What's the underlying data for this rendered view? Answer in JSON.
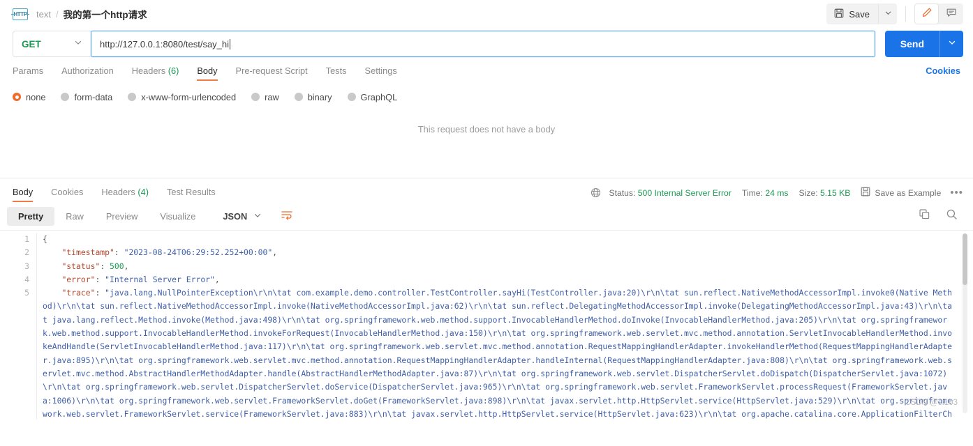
{
  "breadcrumb": {
    "icon": "http-protocol-icon",
    "collection": "text",
    "separator": "/",
    "request_name": "我的第一个http请求"
  },
  "topbar": {
    "save_label": "Save",
    "save_icon": "floppy-disk-icon",
    "save_caret_icon": "chevron-down-icon",
    "edit_icon": "pencil-icon",
    "comment_icon": "comment-icon",
    "accent_orange": "#ef6c2e"
  },
  "url_row": {
    "method": "GET",
    "method_color": "#1a9a52",
    "method_caret_icon": "chevron-down-icon",
    "url": "http://127.0.0.1:8080/test/say_hi",
    "send_label": "Send",
    "send_caret_icon": "chevron-down-icon",
    "send_color": "#1a74e8"
  },
  "request_tabs": [
    {
      "label": "Params",
      "count": "",
      "active": false
    },
    {
      "label": "Authorization",
      "count": "",
      "active": false
    },
    {
      "label": "Headers",
      "count": "(6)",
      "active": false
    },
    {
      "label": "Body",
      "count": "",
      "active": true
    },
    {
      "label": "Pre-request Script",
      "count": "",
      "active": false
    },
    {
      "label": "Tests",
      "count": "",
      "active": false
    },
    {
      "label": "Settings",
      "count": "",
      "active": false
    }
  ],
  "cookies_link": "Cookies",
  "body_types": [
    {
      "label": "none",
      "selected": true
    },
    {
      "label": "form-data",
      "selected": false
    },
    {
      "label": "x-www-form-urlencoded",
      "selected": false
    },
    {
      "label": "raw",
      "selected": false
    },
    {
      "label": "binary",
      "selected": false
    },
    {
      "label": "GraphQL",
      "selected": false
    }
  ],
  "body_empty_message": "This request does not have a body",
  "response": {
    "tabs": [
      {
        "label": "Body",
        "count": "",
        "active": true
      },
      {
        "label": "Cookies",
        "count": "",
        "active": false
      },
      {
        "label": "Headers",
        "count": "(4)",
        "active": false
      },
      {
        "label": "Test Results",
        "count": "",
        "active": false
      }
    ],
    "globe_icon": "globe-icon",
    "status_label": "Status:",
    "status_value": "500 Internal Server Error",
    "time_label": "Time:",
    "time_value": "24 ms",
    "size_label": "Size:",
    "size_value": "5.15 KB",
    "save_example_label": "Save as Example",
    "save_example_icon": "floppy-disk-icon",
    "more_icon": "ellipsis-icon",
    "view_modes": [
      {
        "label": "Pretty",
        "active": true
      },
      {
        "label": "Raw",
        "active": false
      },
      {
        "label": "Preview",
        "active": false
      },
      {
        "label": "Visualize",
        "active": false
      }
    ],
    "format": "JSON",
    "format_caret_icon": "chevron-down-icon",
    "wrap_icon": "word-wrap-icon",
    "copy_icon": "copy-icon",
    "search_icon": "search-icon",
    "status_color": "#1a9a52"
  },
  "code": {
    "line_numbers": [
      "1",
      "2",
      "3",
      "4",
      "5"
    ],
    "lines": [
      {
        "text": "{",
        "type": "punct"
      },
      {
        "key": "\"timestamp\"",
        "value": "\"2023-08-24T06:29:52.252+00:00\"",
        "type": "string",
        "trail": ","
      },
      {
        "key": "\"status\"",
        "value": "500",
        "type": "number",
        "trail": ","
      },
      {
        "key": "\"error\"",
        "value": "\"Internal Server Error\"",
        "type": "string",
        "trail": ","
      },
      {
        "key": "\"trace\"",
        "value": "\"java.lang.NullPointerException\\r\\n\\tat com.example.demo.controller.TestController.sayHi(TestController.java:20)\\r\\n\\tat sun.reflect.NativeMethodAccessorImpl.invoke0(Native Method)\\r\\n\\tat sun.reflect.NativeMethodAccessorImpl.invoke(NativeMethodAccessorImpl.java:62)\\r\\n\\tat sun.reflect.DelegatingMethodAccessorImpl.invoke(DelegatingMethodAccessorImpl.java:43)\\r\\n\\tat java.lang.reflect.Method.invoke(Method.java:498)\\r\\n\\tat org.springframework.web.method.support.InvocableHandlerMethod.doInvoke(InvocableHandlerMethod.java:205)\\r\\n\\tat org.springframework.web.method.support.InvocableHandlerMethod.invokeForRequest(InvocableHandlerMethod.java:150)\\r\\n\\tat org.springframework.web.servlet.mvc.method.annotation.ServletInvocableHandlerMethod.invokeAndHandle(ServletInvocableHandlerMethod.java:117)\\r\\n\\tat org.springframework.web.servlet.mvc.method.annotation.RequestMappingHandlerAdapter.invokeHandlerMethod(RequestMappingHandlerAdapter.java:895)\\r\\n\\tat org.springframework.web.servlet.mvc.method.annotation.RequestMappingHandlerAdapter.handleInternal(RequestMappingHandlerAdapter.java:808)\\r\\n\\tat org.springframework.web.servlet.mvc.method.AbstractHandlerMethodAdapter.handle(AbstractHandlerMethodAdapter.java:87)\\r\\n\\tat org.springframework.web.servlet.DispatcherServlet.doDispatch(DispatcherServlet.java:1072)\\r\\n\\tat org.springframework.web.servlet.DispatcherServlet.doService(DispatcherServlet.java:965)\\r\\n\\tat org.springframework.web.servlet.FrameworkServlet.processRequest(FrameworkServlet.java:1006)\\r\\n\\tat org.springframework.web.servlet.FrameworkServlet.doGet(FrameworkServlet.java:898)\\r\\n\\tat javax.servlet.http.HttpServlet.service(HttpServlet.java:529)\\r\\n\\tat org.springframework.web.servlet.FrameworkServlet.service(FrameworkServlet.java:883)\\r\\n\\tat javax.servlet.http.HttpServlet.service(HttpServlet.java:623)\\r\\n\\tat org.apache.catalina.core.ApplicationFilterChain.internalDoFilter(ApplicationFilterChain.java:209)\\r\\n\\tat org.apache.catalina.core.ApplicationFilterChain.doFilter(ApplicationFilterChain",
        "type": "string",
        "trail": ""
      }
    ]
  },
  "watermark": "CSDN @s:103"
}
